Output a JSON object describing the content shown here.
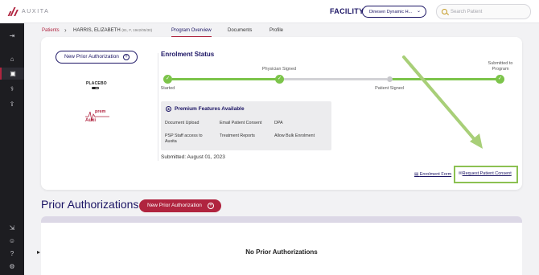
{
  "header": {
    "brand": "AUXITA",
    "facility_label": "FACILITY",
    "facility_value": "Dinesen Dynamic H...",
    "search_placeholder": "Search Patient"
  },
  "breadcrumb": {
    "patients": "Patients",
    "separator": "›",
    "patient_name": "HARRIS, ELIZABETH",
    "patient_meta": "(81, F, 1942/05/30)"
  },
  "tabs": [
    "Program Overview",
    "Documents",
    "Profile"
  ],
  "program_card": {
    "new_pa_label": "New Prior Authorization",
    "logos": {
      "placebo": "PLACEBO",
      "auxiprem_a": "Auxi",
      "auxiprem_b": "prem"
    },
    "enrolment_title": "Enrolment Status",
    "steps": [
      {
        "label": "Started",
        "done": true
      },
      {
        "label": "Physician Signed",
        "done": true
      },
      {
        "label": "Patient Signed",
        "done": false
      },
      {
        "label": "Submitted to Program",
        "done": true
      }
    ],
    "premium_title": "Premium Features Available",
    "features": [
      "Document Upload",
      "Email Patient Consent",
      "DPA",
      "PSP Staff access to Auxita",
      "Treatment Reports",
      "Allow Bulk Enrolment"
    ],
    "submitted": "Submitted: August 01, 2023",
    "enrolment_form": "Enrolment Form",
    "request_consent": "Request Patient Consent"
  },
  "prior_auth": {
    "title": "Prior Authorizations",
    "new_button": "New Prior Authorization",
    "empty": "No Prior Authorizations"
  },
  "colors": {
    "accent": "#b0243f",
    "navy": "#1b1464",
    "success": "#7cc44a",
    "highlight": "#8cc152"
  }
}
